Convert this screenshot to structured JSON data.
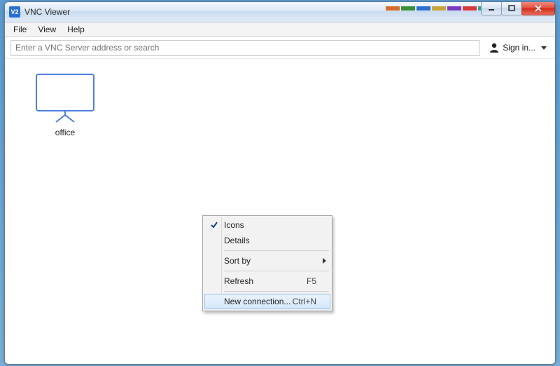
{
  "window": {
    "title": "VNC Viewer",
    "app_icon_text": "V2"
  },
  "menubar": {
    "items": [
      "File",
      "View",
      "Help"
    ]
  },
  "toolbar": {
    "address_placeholder": "Enter a VNC Server address or search",
    "sign_in_label": "Sign in..."
  },
  "connections": [
    {
      "label": "office"
    }
  ],
  "context_menu": {
    "items": [
      {
        "label": "Icons",
        "checked": true,
        "submenu": false,
        "accel": "",
        "highlight": false
      },
      {
        "label": "Details",
        "checked": false,
        "submenu": false,
        "accel": "",
        "highlight": false
      },
      {
        "separator": true
      },
      {
        "label": "Sort by",
        "checked": false,
        "submenu": true,
        "accel": "",
        "highlight": false
      },
      {
        "separator": true
      },
      {
        "label": "Refresh",
        "checked": false,
        "submenu": false,
        "accel": "F5",
        "highlight": false
      },
      {
        "separator": true
      },
      {
        "label": "New connection...",
        "checked": false,
        "submenu": false,
        "accel": "Ctrl+N",
        "highlight": true
      }
    ]
  },
  "title_color_strip": [
    "#d86b2c",
    "#3a8f3a",
    "#2c6fd0",
    "#c8a23a",
    "#7a3bbf",
    "#d63a3a",
    "#2aa198"
  ]
}
